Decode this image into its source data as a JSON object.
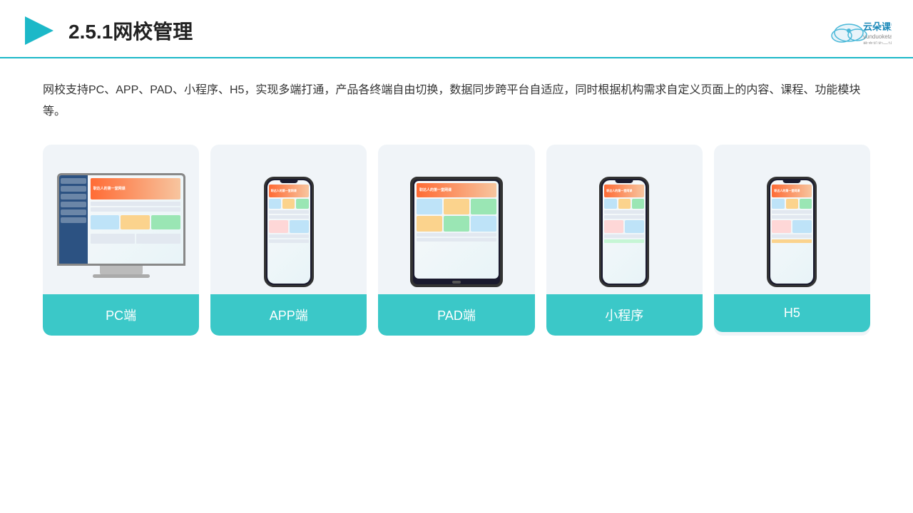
{
  "header": {
    "title": "2.5.1网校管理",
    "logo_name": "云朵课堂",
    "logo_sub": "yunduoketang.com",
    "logo_tagline": "教育机构一站式服务云平台"
  },
  "description": "网校支持PC、APP、PAD、小程序、H5，实现多端打通，产品各终端自由切换，数据同步跨平台自适应，同时根据机构需求自定义页面上的内容、课程、功能模块等。",
  "cards": [
    {
      "id": "pc",
      "label": "PC端",
      "type": "pc"
    },
    {
      "id": "app",
      "label": "APP端",
      "type": "phone"
    },
    {
      "id": "pad",
      "label": "PAD端",
      "type": "tablet"
    },
    {
      "id": "miniapp",
      "label": "小程序",
      "type": "phone"
    },
    {
      "id": "h5",
      "label": "H5",
      "type": "phone"
    }
  ],
  "colors": {
    "accent": "#3bc8c8",
    "header_border": "#1cb8c8",
    "title": "#222222",
    "text": "#333333"
  }
}
